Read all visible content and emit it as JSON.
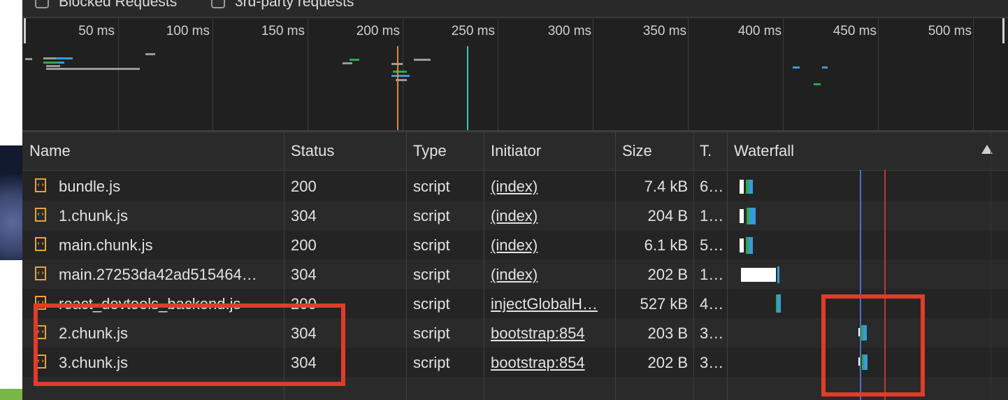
{
  "filters": {
    "blocked_requests": "Blocked Requests",
    "third_party": "3rd-party requests"
  },
  "overview": {
    "ticks": [
      "50 ms",
      "100 ms",
      "150 ms",
      "200 ms",
      "250 ms",
      "300 ms",
      "350 ms",
      "400 ms",
      "450 ms",
      "500 ms"
    ]
  },
  "columns": {
    "name": "Name",
    "status": "Status",
    "type": "Type",
    "initiator": "Initiator",
    "size": "Size",
    "time": "T.",
    "waterfall": "Waterfall"
  },
  "rows": [
    {
      "name": "bundle.js",
      "status": "200",
      "type": "script",
      "initiator": "(index)",
      "size": "7.4 kB",
      "time": "6…"
    },
    {
      "name": "1.chunk.js",
      "status": "304",
      "type": "script",
      "initiator": "(index)",
      "size": "204 B",
      "time": "1…"
    },
    {
      "name": "main.chunk.js",
      "status": "200",
      "type": "script",
      "initiator": "(index)",
      "size": "6.1 kB",
      "time": "5…"
    },
    {
      "name": "main.27253da42ad515464…",
      "status": "304",
      "type": "script",
      "initiator": "(index)",
      "size": "202 B",
      "time": "1…"
    },
    {
      "name": "react_devtools_backend.js",
      "status": "200",
      "type": "script",
      "initiator": "injectGlobalH…",
      "size": "527 kB",
      "time": "4…"
    },
    {
      "name": "2.chunk.js",
      "status": "304",
      "type": "script",
      "initiator": "bootstrap:854",
      "size": "203 B",
      "time": "3…"
    },
    {
      "name": "3.chunk.js",
      "status": "304",
      "type": "script",
      "initiator": "bootstrap:854",
      "size": "202 B",
      "time": "3…"
    }
  ],
  "colors": {
    "annotation": "#e23b2a",
    "dom_content_loaded": "#4a6fd6",
    "load_event": "#c0392b",
    "waiting": "#2ea84e",
    "download": "#3a9ad9"
  }
}
